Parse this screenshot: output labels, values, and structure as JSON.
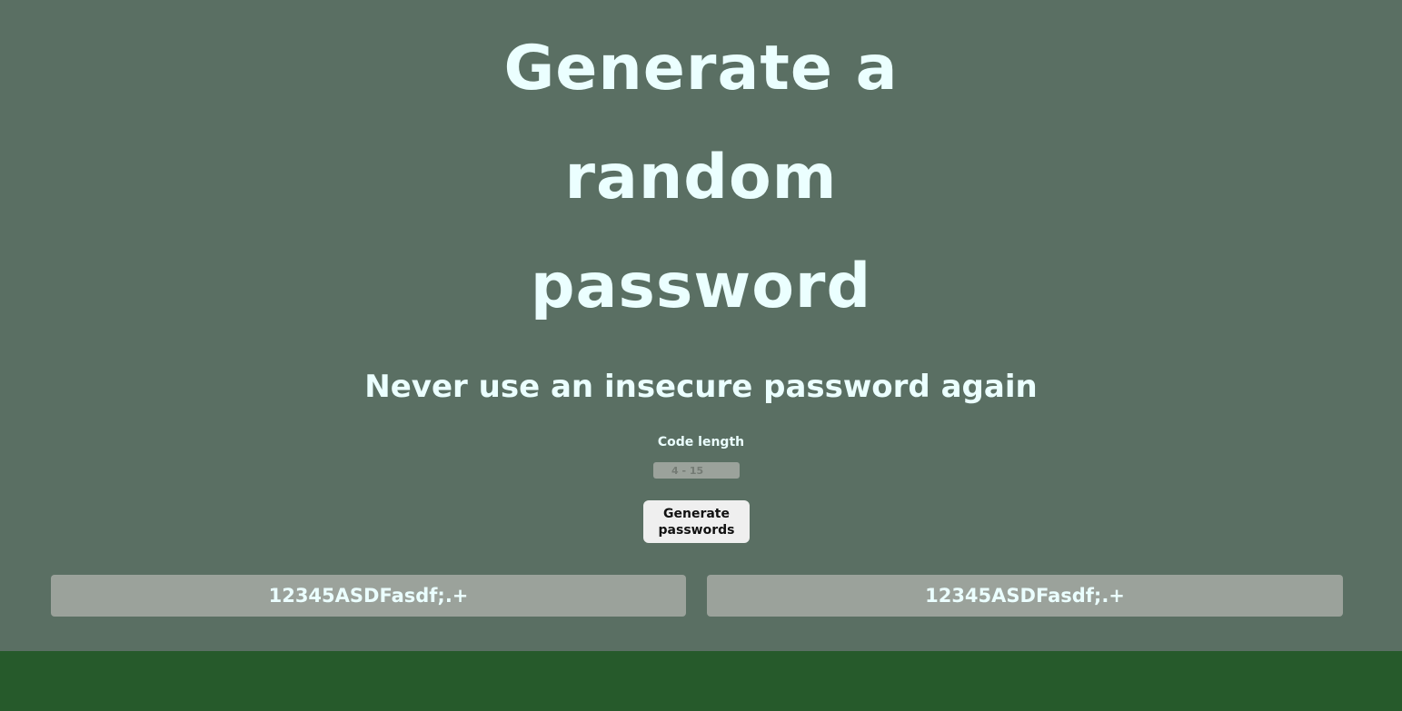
{
  "hero": {
    "title_lines": [
      "Generate a",
      "random",
      "password"
    ],
    "subtitle": "Never use an insecure password again"
  },
  "controls": {
    "length_label": "Code length",
    "length_placeholder": "4 - 15",
    "generate_label": "Generate passwords"
  },
  "passwords": [
    "12345ASDFasdf;.+",
    "12345ASDFasdf;.+"
  ],
  "colors": {
    "background": "#5a6f63",
    "footer": "#265a2b",
    "text": "#ebffff",
    "field": "#9ba29b",
    "button": "#efefef"
  }
}
